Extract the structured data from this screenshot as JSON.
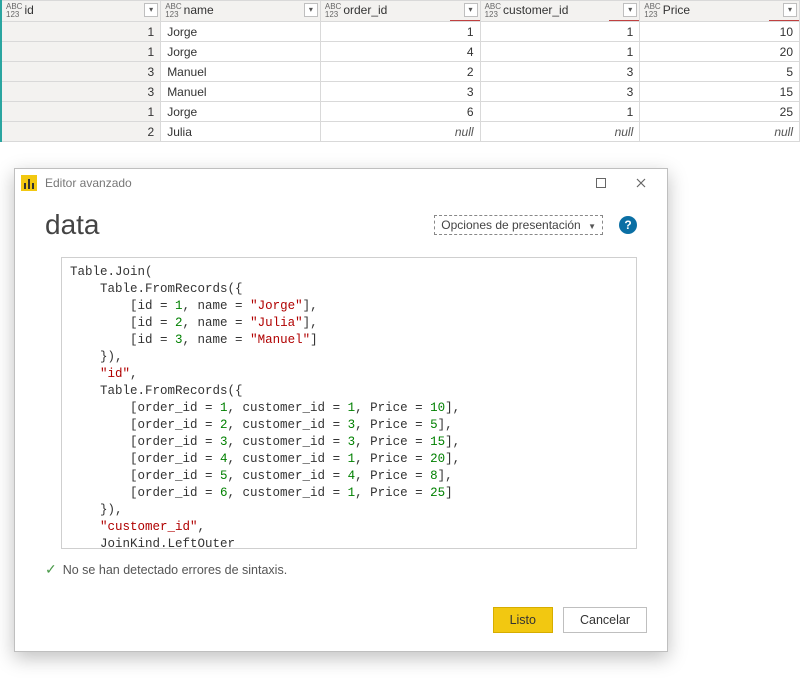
{
  "table": {
    "columns": [
      {
        "name": "id",
        "type_top": "ABC",
        "type_bot": "123",
        "red": false
      },
      {
        "name": "name",
        "type_top": "ABC",
        "type_bot": "123",
        "red": false
      },
      {
        "name": "order_id",
        "type_top": "ABC",
        "type_bot": "123",
        "red": true
      },
      {
        "name": "customer_id",
        "type_top": "ABC",
        "type_bot": "123",
        "red": true
      },
      {
        "name": "Price",
        "type_top": "ABC",
        "type_bot": "123",
        "red": true
      }
    ],
    "rows": [
      {
        "id": "1",
        "name": "Jorge",
        "order_id": "1",
        "customer_id": "1",
        "price": "10"
      },
      {
        "id": "1",
        "name": "Jorge",
        "order_id": "4",
        "customer_id": "1",
        "price": "20"
      },
      {
        "id": "3",
        "name": "Manuel",
        "order_id": "2",
        "customer_id": "3",
        "price": "5"
      },
      {
        "id": "3",
        "name": "Manuel",
        "order_id": "3",
        "customer_id": "3",
        "price": "15"
      },
      {
        "id": "1",
        "name": "Jorge",
        "order_id": "6",
        "customer_id": "1",
        "price": "25"
      },
      {
        "id": "2",
        "name": "Julia",
        "order_id": null,
        "customer_id": null,
        "price": null
      }
    ]
  },
  "modal": {
    "window_title": "Editor avanzado",
    "heading": "data",
    "display_options": "Opciones de presentación",
    "help_char": "?",
    "status_text": "No se han detectado errores de sintaxis.",
    "btn_done": "Listo",
    "btn_cancel": "Cancelar",
    "code": {
      "l1": "Table.Join(",
      "l2": "    Table.FromRecords({",
      "l3a": "        [id = ",
      "l3b": ", name = ",
      "l3c": "],",
      "v3n": "1",
      "v3s": "\"Jorge\"",
      "v4n": "2",
      "v4s": "\"Julia\"",
      "v5n": "3",
      "v5s": "\"Manuel\"",
      "l5c": "]",
      "l6": "    }),",
      "l7": "    ",
      "l7s": "\"id\"",
      "l7c": ",",
      "l8": "    Table.FromRecords({",
      "rowp1": "        [order_id = ",
      "rowp2": ", customer_id = ",
      "rowp3": ", Price = ",
      "rowp4": "],",
      "rowp4last": "]",
      "r1o": "1",
      "r1c": "1",
      "r1p": "10",
      "r2o": "2",
      "r2c": "3",
      "r2p": "5",
      "r3o": "3",
      "r3c": "3",
      "r3p": "15",
      "r4o": "4",
      "r4c": "1",
      "r4p": "20",
      "r5o": "5",
      "r5c": "4",
      "r5p": "8",
      "r6o": "6",
      "r6c": "1",
      "r6p": "25",
      "l16": "    }),",
      "l17": "    ",
      "l17s": "\"customer_id\"",
      "l17c": ",",
      "l18": "    JoinKind.LeftOuter",
      "l19": ")"
    }
  }
}
